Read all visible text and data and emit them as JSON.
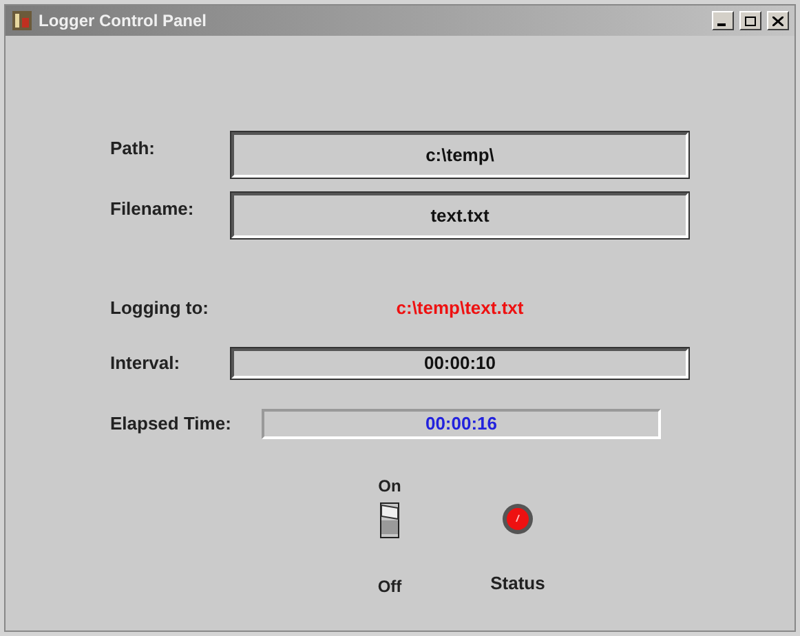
{
  "window": {
    "title": "Logger Control Panel"
  },
  "fields": [
    {
      "label": "Path:",
      "value": "c:\\temp\\"
    },
    {
      "label": "Filename:",
      "value": "text.txt"
    }
  ],
  "logging": {
    "label": "Logging to:",
    "value": "c:\\temp\\text.txt"
  },
  "interval": {
    "label": "Interval:",
    "value": "00:00:10"
  },
  "elapsed": {
    "label": "Elapsed Time:",
    "value": "00:00:16"
  },
  "switch": {
    "on_label": "On",
    "off_label": "Off",
    "on": true
  },
  "status": {
    "label": "Status",
    "lit": true
  }
}
